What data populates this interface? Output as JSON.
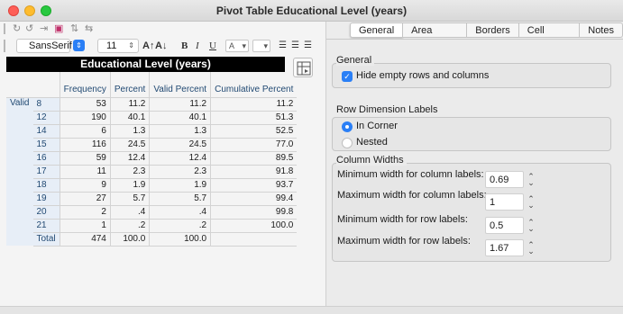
{
  "window": {
    "title": "Pivot Table Educational Level (years)"
  },
  "toolbar": {
    "font_name": "SansSerif",
    "font_size": "11",
    "bold": "B",
    "italic": "I",
    "underline": "U",
    "text_color": "A",
    "grow_font": "A↑",
    "shrink_font": "A↓"
  },
  "pivot": {
    "title": "Educational Level (years)",
    "columns": [
      "Frequency",
      "Percent",
      "Valid Percent",
      "Cumulative Percent"
    ],
    "group_label": "Valid",
    "rows": [
      {
        "label": "8",
        "frequency": "53",
        "percent": "11.2",
        "valid_percent": "11.2",
        "cumulative": "11.2"
      },
      {
        "label": "12",
        "frequency": "190",
        "percent": "40.1",
        "valid_percent": "40.1",
        "cumulative": "51.3"
      },
      {
        "label": "14",
        "frequency": "6",
        "percent": "1.3",
        "valid_percent": "1.3",
        "cumulative": "52.5"
      },
      {
        "label": "15",
        "frequency": "116",
        "percent": "24.5",
        "valid_percent": "24.5",
        "cumulative": "77.0"
      },
      {
        "label": "16",
        "frequency": "59",
        "percent": "12.4",
        "valid_percent": "12.4",
        "cumulative": "89.5"
      },
      {
        "label": "17",
        "frequency": "11",
        "percent": "2.3",
        "valid_percent": "2.3",
        "cumulative": "91.8"
      },
      {
        "label": "18",
        "frequency": "9",
        "percent": "1.9",
        "valid_percent": "1.9",
        "cumulative": "93.7"
      },
      {
        "label": "19",
        "frequency": "27",
        "percent": "5.7",
        "valid_percent": "5.7",
        "cumulative": "99.4"
      },
      {
        "label": "20",
        "frequency": "2",
        "percent": ".4",
        "valid_percent": ".4",
        "cumulative": "99.8"
      },
      {
        "label": "21",
        "frequency": "1",
        "percent": ".2",
        "valid_percent": ".2",
        "cumulative": "100.0"
      }
    ],
    "total": {
      "label": "Total",
      "frequency": "474",
      "percent": "100.0",
      "valid_percent": "100.0",
      "cumulative": ""
    }
  },
  "tabs": [
    "General",
    "Area Format",
    "Borders",
    "Cell Format",
    "Notes"
  ],
  "general": {
    "section_general": "General",
    "hide_empty_label": "Hide empty rows and columns",
    "hide_empty_checked": true,
    "section_row_dim": "Row Dimension Labels",
    "in_corner_label": "In Corner",
    "nested_label": "Nested",
    "row_dim_selected": "In Corner",
    "section_col_widths": "Column Widths",
    "min_col_label": "Minimum width for column labels:",
    "min_col_value": "0.69",
    "max_col_label": "Maximum width for column labels:",
    "max_col_value": "1",
    "min_row_label": "Minimum width for row labels:",
    "min_row_value": "0.5",
    "max_row_label": "Maximum width for row labels:",
    "max_row_value": "1.67"
  },
  "colors": {
    "accent": "#2a7ff6",
    "row_header_bg": "#e7eef7",
    "title_bg": "#000000"
  }
}
